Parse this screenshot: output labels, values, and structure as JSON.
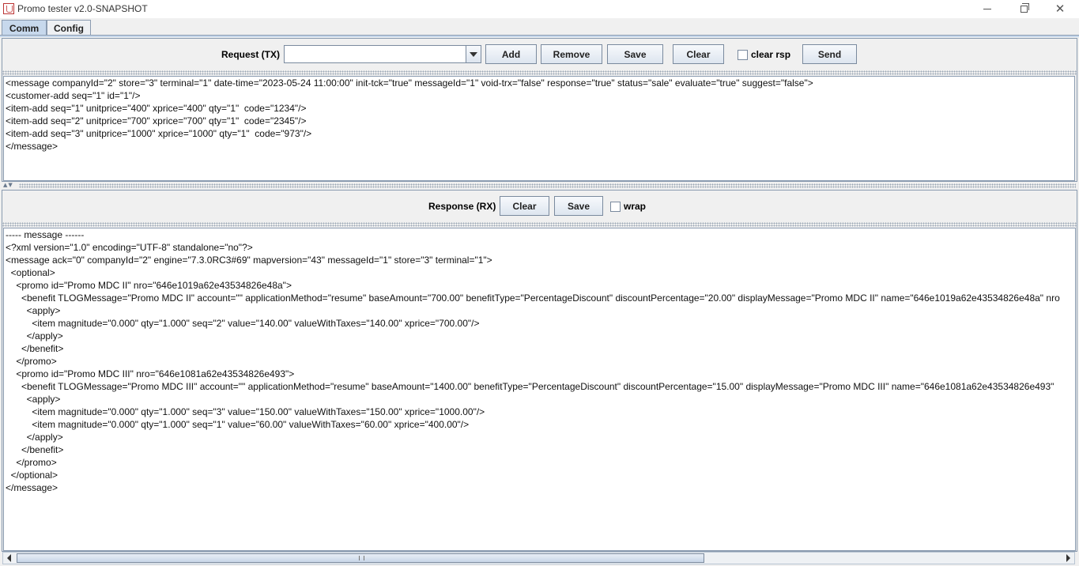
{
  "window": {
    "title": "Promo tester v2.0-SNAPSHOT"
  },
  "tabs": [
    {
      "label": "Comm",
      "active": true
    },
    {
      "label": "Config",
      "active": false
    }
  ],
  "request": {
    "label": "Request (TX)",
    "combo_value": "",
    "buttons": {
      "add": "Add",
      "remove": "Remove",
      "save": "Save",
      "clear": "Clear",
      "send": "Send"
    },
    "clear_rsp_label": "clear rsp",
    "clear_rsp_checked": false,
    "lines": [
      "<message companyId=\"2\" store=\"3\" terminal=\"1\" date-time=\"2023-05-24 11:00:00\" init-tck=\"true\" messageId=\"1\" void-trx=\"false\" response=\"true\" status=\"sale\" evaluate=\"true\" suggest=\"false\">",
      "<customer-add seq=\"1\" id=\"1\"/>",
      "<item-add seq=\"1\" unitprice=\"400\" xprice=\"400\" qty=\"1\"  code=\"1234\"/>",
      "<item-add seq=\"2\" unitprice=\"700\" xprice=\"700\" qty=\"1\"  code=\"2345\"/>",
      "<item-add seq=\"3\" unitprice=\"1000\" xprice=\"1000\" qty=\"1\"  code=\"973\"/>",
      "</message>"
    ]
  },
  "response": {
    "label": "Response (RX)",
    "buttons": {
      "clear": "Clear",
      "save": "Save"
    },
    "wrap_label": "wrap",
    "wrap_checked": false,
    "lines": [
      "----- message ------",
      "<?xml version=\"1.0\" encoding=\"UTF-8\" standalone=\"no\"?>",
      "<message ack=\"0\" companyId=\"2\" engine=\"7.3.0RC3#69\" mapversion=\"43\" messageId=\"1\" store=\"3\" terminal=\"1\">",
      "  <optional>",
      "    <promo id=\"Promo MDC II\" nro=\"646e1019a62e43534826e48a\">",
      "      <benefit TLOGMessage=\"Promo MDC II\" account=\"\" applicationMethod=\"resume\" baseAmount=\"700.00\" benefitType=\"PercentageDiscount\" discountPercentage=\"20.00\" displayMessage=\"Promo MDC II\" name=\"646e1019a62e43534826e48a\" nro",
      "        <apply>",
      "          <item magnitude=\"0.000\" qty=\"1.000\" seq=\"2\" value=\"140.00\" valueWithTaxes=\"140.00\" xprice=\"700.00\"/>",
      "        </apply>",
      "      </benefit>",
      "    </promo>",
      "    <promo id=\"Promo MDC III\" nro=\"646e1081a62e43534826e493\">",
      "      <benefit TLOGMessage=\"Promo MDC III\" account=\"\" applicationMethod=\"resume\" baseAmount=\"1400.00\" benefitType=\"PercentageDiscount\" discountPercentage=\"15.00\" displayMessage=\"Promo MDC III\" name=\"646e1081a62e43534826e493\"",
      "        <apply>",
      "          <item magnitude=\"0.000\" qty=\"1.000\" seq=\"3\" value=\"150.00\" valueWithTaxes=\"150.00\" xprice=\"1000.00\"/>",
      "          <item magnitude=\"0.000\" qty=\"1.000\" seq=\"1\" value=\"60.00\" valueWithTaxes=\"60.00\" xprice=\"400.00\"/>",
      "        </apply>",
      "      </benefit>",
      "    </promo>",
      "  </optional>",
      "</message>"
    ]
  },
  "icons": {
    "app": "java-cup-icon",
    "minimize": "minimize-icon",
    "maximize": "restore-icon",
    "close": "close-icon",
    "combo": "chevron-down-icon",
    "divider": "split-arrows-icon",
    "scroll_left": "arrow-left-icon",
    "scroll_right": "arrow-right-icon"
  },
  "colors": {
    "tab_active": "#c7d8ec",
    "border": "#8a9bb0"
  }
}
